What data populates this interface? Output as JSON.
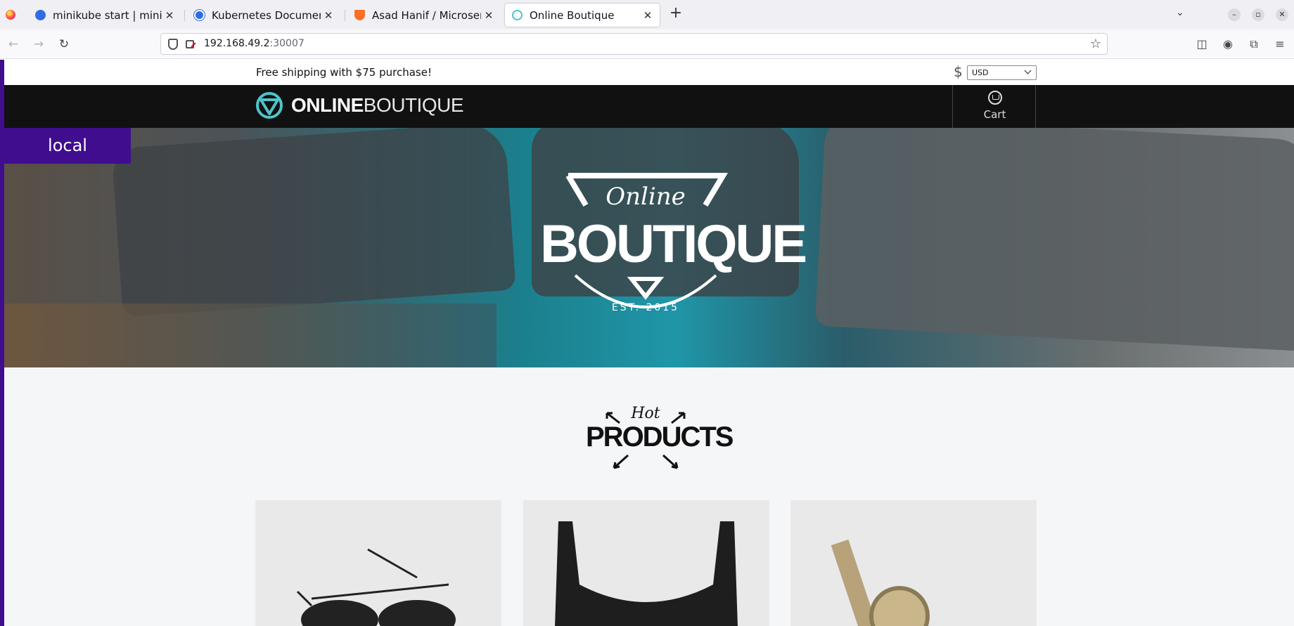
{
  "browser": {
    "tabs": [
      {
        "title": "minikube start | minikube",
        "active": false,
        "icon": "minikube-favicon-icon"
      },
      {
        "title": "Kubernetes Documentati",
        "active": false,
        "icon": "kubernetes-favicon-icon"
      },
      {
        "title": "Asad Hanif / Microservice",
        "active": false,
        "icon": "gitlab-favicon-icon"
      },
      {
        "title": "Online Boutique",
        "active": true,
        "icon": "boutique-favicon-icon"
      }
    ],
    "url": {
      "host": "192.168.49.2",
      "port": ":30007"
    }
  },
  "page": {
    "shipping_text": "Free shipping with $75 purchase!",
    "currency_symbol": "$",
    "currency_selected": "USD",
    "logo": {
      "bold": "ONLINE",
      "light": "BOUTIQUE"
    },
    "cart_label": "Cart",
    "local_badge": "local",
    "hero": {
      "online": "Online",
      "boutique": "BOUTIQUE",
      "est": "EST. 2015"
    },
    "hot": {
      "hot": "Hot",
      "products": "PRODUCTS"
    },
    "products": [
      {
        "name": "sunglasses"
      },
      {
        "name": "tank-top"
      },
      {
        "name": "watch"
      }
    ],
    "colors": {
      "accent": "#3f0d8e",
      "header": "#111111",
      "logo_teal": "#4fc3c9"
    }
  }
}
